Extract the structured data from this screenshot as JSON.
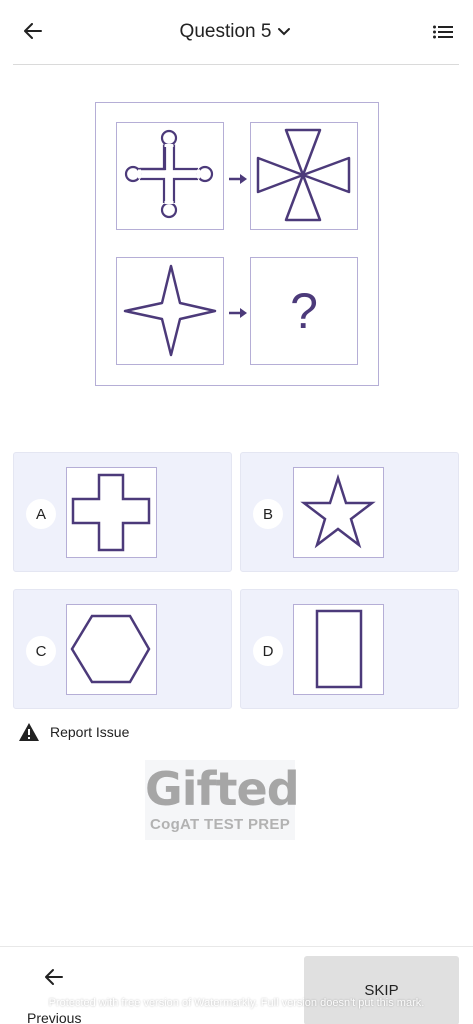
{
  "header": {
    "title": "Question 5",
    "back_icon": "arrow-left-icon",
    "dropdown_icon": "chevron-down-icon",
    "menu_icon": "list-icon"
  },
  "puzzle": {
    "question_mark": "?",
    "shape_color": "#4c3a7a",
    "border_color": "#b5aed6"
  },
  "options": [
    {
      "letter": "A",
      "shape": "cross"
    },
    {
      "letter": "B",
      "shape": "star"
    },
    {
      "letter": "C",
      "shape": "hexagon"
    },
    {
      "letter": "D",
      "shape": "rectangle"
    }
  ],
  "report": {
    "label": "Report Issue",
    "icon": "warning-icon"
  },
  "logo": {
    "word": "Gifted",
    "subtitle": "CogAT TEST PREP"
  },
  "footer": {
    "previous_label": "Previous",
    "skip_label": "SKIP"
  },
  "watermark": "Protected with free version of Watermarkly. Full version doesn't put this mark.",
  "colors": {
    "accent": "#4c3a7a",
    "option_bg": "#eff1fb",
    "skip_bg": "#e0e0e0"
  }
}
